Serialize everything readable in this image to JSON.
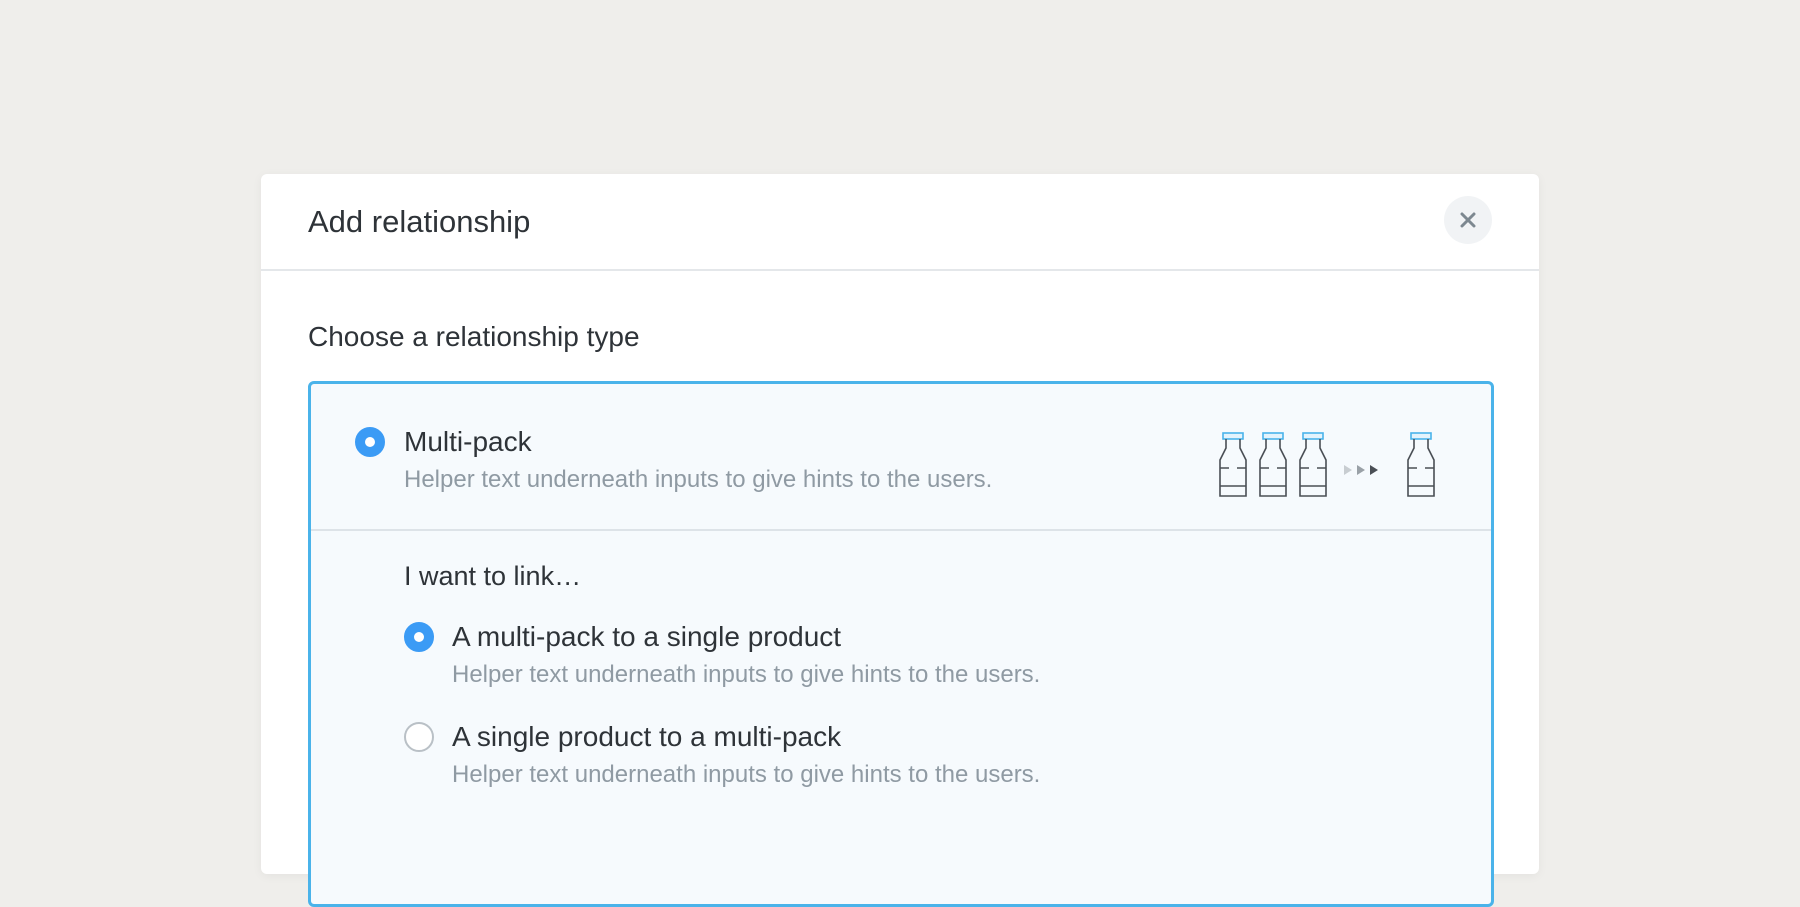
{
  "modal": {
    "title": "Add relationship",
    "close_icon": "close-icon"
  },
  "section_title": "Choose a relationship type",
  "option": {
    "label": "Multi-pack",
    "help": "Helper text underneath inputs to give hints to the users.",
    "selected": true,
    "illustration_icon": "bottles-to-bottle-icon"
  },
  "link": {
    "title": "I want to link…",
    "choices": [
      {
        "label": "A multi-pack to a single product",
        "help": "Helper text underneath inputs to give hints to the users.",
        "selected": true
      },
      {
        "label": "A single product to a multi-pack",
        "help": "Helper text underneath inputs to give hints to the users.",
        "selected": false
      }
    ]
  },
  "colors": {
    "accent": "#3b9bf5",
    "card_border": "#4ab3ea",
    "card_background": "#f6fafd",
    "page_background": "#efeeeb"
  }
}
